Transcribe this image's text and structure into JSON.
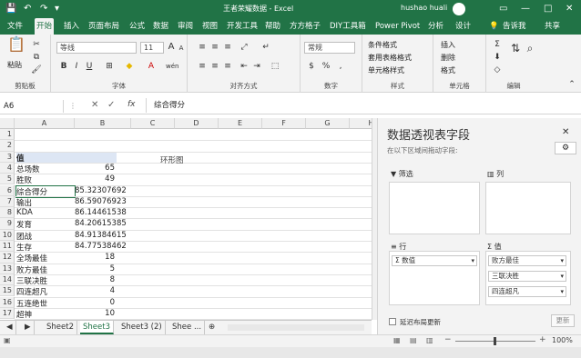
{
  "window": {
    "title": "王者荣耀数据 - Excel",
    "user": "hushao huali",
    "min_glyph": "—",
    "max_glyph": "□",
    "close_glyph": "✕"
  },
  "qat": {
    "save_icon": "save-icon",
    "undo_icon": "undo-icon",
    "redo_icon": "redo-icon"
  },
  "tabs": [
    "文件",
    "开始",
    "插入",
    "页面布局",
    "公式",
    "数据",
    "审阅",
    "视图",
    "开发工具",
    "帮助",
    "方方格子",
    "DIY工具箱",
    "Power Pivot",
    "分析",
    "设计"
  ],
  "active_tab": "开始",
  "tell": "告诉我",
  "share": "共享",
  "ribbon": {
    "clipboard": {
      "label": "剪贴板",
      "paste": "粘贴"
    },
    "font": {
      "label": "字体",
      "font_name": "等线",
      "font_size": "11",
      "bold": "B",
      "italic": "I",
      "underline": "U",
      "grow": "A",
      "shrink": "A",
      "wen": "wén"
    },
    "align": {
      "label": "对齐方式"
    },
    "number": {
      "label": "数字",
      "format": "常规",
      "percent": "%"
    },
    "styles": {
      "label": "样式",
      "cond": "条件格式",
      "table": "套用表格格式",
      "cell": "单元格样式"
    },
    "cells": {
      "label": "单元格",
      "insert": "插入",
      "delete": "删除",
      "format": "格式"
    },
    "edit": {
      "label": "编辑"
    }
  },
  "formula_bar": {
    "name_box": "A6",
    "fx": "fx",
    "value": "综合得分"
  },
  "columns": [
    "A",
    "B",
    "C",
    "D",
    "E",
    "F",
    "G",
    "H"
  ],
  "rows": [
    {
      "n": "1",
      "a": "",
      "b": ""
    },
    {
      "n": "2",
      "a": "",
      "b": ""
    },
    {
      "n": "3",
      "a": "值",
      "b": ""
    },
    {
      "n": "4",
      "a": "总场数",
      "b": "65"
    },
    {
      "n": "5",
      "a": "胜败",
      "b": "49"
    },
    {
      "n": "6",
      "a": "综合得分",
      "b": "85.32307692"
    },
    {
      "n": "7",
      "a": "输出",
      "b": "86.59076923"
    },
    {
      "n": "8",
      "a": "KDA",
      "b": "86.14461538"
    },
    {
      "n": "9",
      "a": "发育",
      "b": "84.20615385"
    },
    {
      "n": "10",
      "a": "团战",
      "b": "84.91384615"
    },
    {
      "n": "11",
      "a": "生存",
      "b": "84.77538462"
    },
    {
      "n": "12",
      "a": "全场最佳",
      "b": "18"
    },
    {
      "n": "13",
      "a": "败方最佳",
      "b": "5"
    },
    {
      "n": "14",
      "a": "三联决胜",
      "b": "8"
    },
    {
      "n": "15",
      "a": "四连超凡",
      "b": "4"
    },
    {
      "n": "16",
      "a": "五连绝世",
      "b": "0"
    },
    {
      "n": "17",
      "a": "超神",
      "b": "10"
    }
  ],
  "chart_title": "环形图",
  "sheet_tabs": [
    "Sheet2",
    "Sheet3",
    "Sheet3 (2)",
    "Shee ..."
  ],
  "active_sheet": "Sheet3",
  "status": {
    "zoom": "100%",
    "minus": "−",
    "plus": "+"
  },
  "pivot": {
    "title": "数据透视表字段",
    "subtitle": "在以下区域间拖动字段:",
    "filters": "筛选",
    "columns": "列",
    "rows": "行",
    "values": "值",
    "row_item": "Σ 数值",
    "value_items": [
      "败方最佳",
      "三联决胜",
      "四连超凡"
    ],
    "defer": "延迟布局更新",
    "update": "更新",
    "close": "✕",
    "dropdown": "▾",
    "gear": "⚙"
  }
}
